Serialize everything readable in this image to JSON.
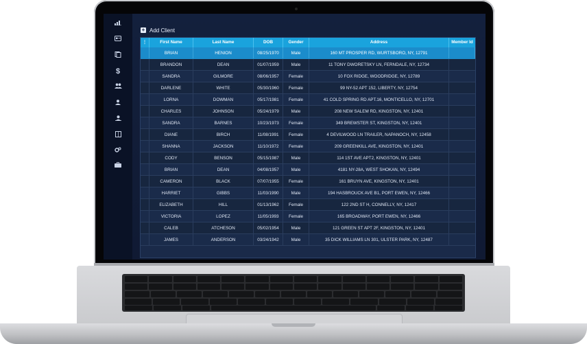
{
  "toolbar": {
    "add_client_label": "Add Client"
  },
  "sidebar": {
    "icons": [
      {
        "name": "bar-chart-icon",
        "glyph": ""
      },
      {
        "name": "id-card-icon",
        "glyph": ""
      },
      {
        "name": "documents-icon",
        "glyph": ""
      },
      {
        "name": "dollar-icon",
        "glyph": "$"
      },
      {
        "name": "users-icon",
        "glyph": ""
      },
      {
        "name": "user-icon",
        "glyph": ""
      },
      {
        "name": "user-account-icon",
        "glyph": ""
      },
      {
        "name": "book-icon",
        "glyph": ""
      },
      {
        "name": "settings-icon",
        "glyph": ""
      },
      {
        "name": "briefcase-icon",
        "glyph": ""
      }
    ]
  },
  "table": {
    "columns": [
      "First Name",
      "Last Name",
      "DOB",
      "Gender",
      "Address",
      "Member Id"
    ],
    "rows": [
      [
        "BRIAN",
        "HENION",
        "08/25/1970",
        "Male",
        "160 MT PROSPER RD, WURTSBORO, NY, 12791",
        ""
      ],
      [
        "BRANDON",
        "DEAN",
        "01/07/1959",
        "Male",
        "11 TONY DWORETSKY LN, FERNDALE, NY, 12734",
        ""
      ],
      [
        "SANDRA",
        "GILMORE",
        "08/06/1957",
        "Female",
        "10 FOX RIDGE, WOODRIDGE, NY, 12789",
        ""
      ],
      [
        "DARLENE",
        "WHITE",
        "05/30/1960",
        "Female",
        "99 NY-52 APT 152, LIBERTY, NY, 12754",
        ""
      ],
      [
        "LORNA",
        "DOWMAN",
        "05/17/1981",
        "Female",
        "41 COLD SPRING RD APT.16, MONTICELLO, NY, 12701",
        ""
      ],
      [
        "CHARLES",
        "JOHNSON",
        "05/24/1979",
        "Male",
        "208 NEW SALEM RD, KINGSTON, NY, 12401",
        ""
      ],
      [
        "SANDRA",
        "BARNES",
        "10/23/1973",
        "Female",
        "349 BREWSTER ST, KINGSTON, NY, 12401",
        ""
      ],
      [
        "DIANE",
        "BIRCH",
        "11/08/1991",
        "Female",
        "4 DEVILWOOD LN TRAILER, NAPANOCH, NY, 12458",
        ""
      ],
      [
        "SHANNA",
        "JACKSON",
        "11/10/1972",
        "Female",
        "209 GREENKILL AVE, KINGSTON, NY, 12401",
        ""
      ],
      [
        "CODY",
        "BENSON",
        "05/15/1987",
        "Male",
        "114 1ST AVE APT2, KINGSTON, NY, 12401",
        ""
      ],
      [
        "BRIAN",
        "DEAN",
        "04/08/1957",
        "Male",
        "4181 NY-28A, WEST SHOKAN, NY, 12494",
        ""
      ],
      [
        "CAMERON",
        "BLACK",
        "07/07/1955",
        "Female",
        "161 BRUYN AVE, KINGSTON, NY, 12401",
        ""
      ],
      [
        "HARRIET",
        "GIBBS",
        "11/03/1990",
        "Male",
        "194 HASBROUCK AVE B1, PORT EWEN, NY, 12466",
        ""
      ],
      [
        "ELIZABETH",
        "HILL",
        "01/13/1962",
        "Female",
        "122 2ND ST H, CONNELLY, NY, 12417",
        ""
      ],
      [
        "VICTORIA",
        "LOPEZ",
        "11/05/1993",
        "Female",
        "165 BROADWAY, PORT EWEN, NY, 12466",
        ""
      ],
      [
        "CALEB",
        "ATCHESON",
        "05/02/1954",
        "Male",
        "121 GREEN ST APT 2F, KINGSTON, NY, 12401",
        ""
      ],
      [
        "JAMES",
        "ANDERSON",
        "03/24/1942",
        "Male",
        "35 DICK WILLIAMS LN 301, ULSTER PARK, NY, 12487",
        ""
      ]
    ],
    "selected_row": 0
  },
  "colors": {
    "header": "#1aa3dd",
    "selected_row": "#1b8ccb",
    "background": "#101a33"
  }
}
